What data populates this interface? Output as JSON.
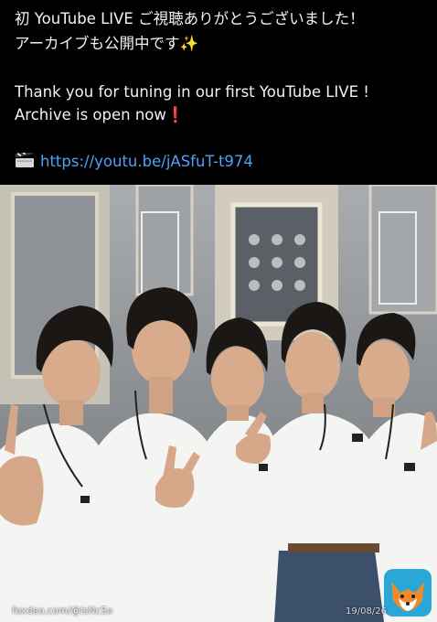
{
  "post": {
    "line1": "初 YouTube LIVE ご視聴ありがとうございました！",
    "line2_text": "アーカイブも公開中です",
    "line2_emoji": "✨",
    "line3": "Thank you for tuning in our first YouTube LIVE !",
    "line4_text": "Archive is open now",
    "line4_emoji": "❗",
    "link_icon": "clapper-board-icon",
    "link": "https://youtu.be/jASfuT-t974"
  },
  "photo": {
    "watermark_left": "foxdeo.com/@lsNcSo",
    "watermark_date": "19/08/26",
    "logo_icon": "fox-logo-icon"
  },
  "colors": {
    "link": "#4ea1f5",
    "background": "#000000",
    "exclaim": "#e0242b"
  }
}
